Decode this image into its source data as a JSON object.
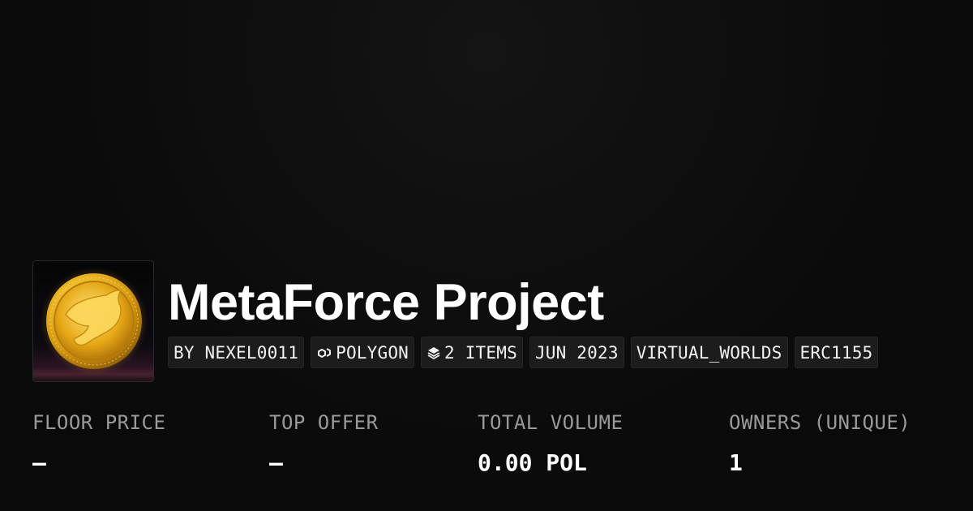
{
  "collection": {
    "name": "MetaForce Project",
    "tags": [
      {
        "label": "BY NEXEL0011",
        "icon": null
      },
      {
        "label": "POLYGON",
        "icon": "polygon-chain-icon"
      },
      {
        "label": "2 ITEMS",
        "icon": "layers-icon"
      },
      {
        "label": "JUN 2023",
        "icon": null
      },
      {
        "label": "VIRTUAL_WORLDS",
        "icon": null
      },
      {
        "label": "ERC1155",
        "icon": null
      }
    ]
  },
  "stats": [
    {
      "label": "FLOOR PRICE",
      "value": "–"
    },
    {
      "label": "TOP OFFER",
      "value": "–"
    },
    {
      "label": "TOTAL VOLUME",
      "value": "0.00 POL"
    },
    {
      "label": "OWNERS (UNIQUE)",
      "value": "1"
    }
  ],
  "colors": {
    "background": "#0b0b0b",
    "tag_background": "#1c1c1c",
    "label_gray": "#9a9a9a",
    "coin_gold": "#e0a21a"
  }
}
